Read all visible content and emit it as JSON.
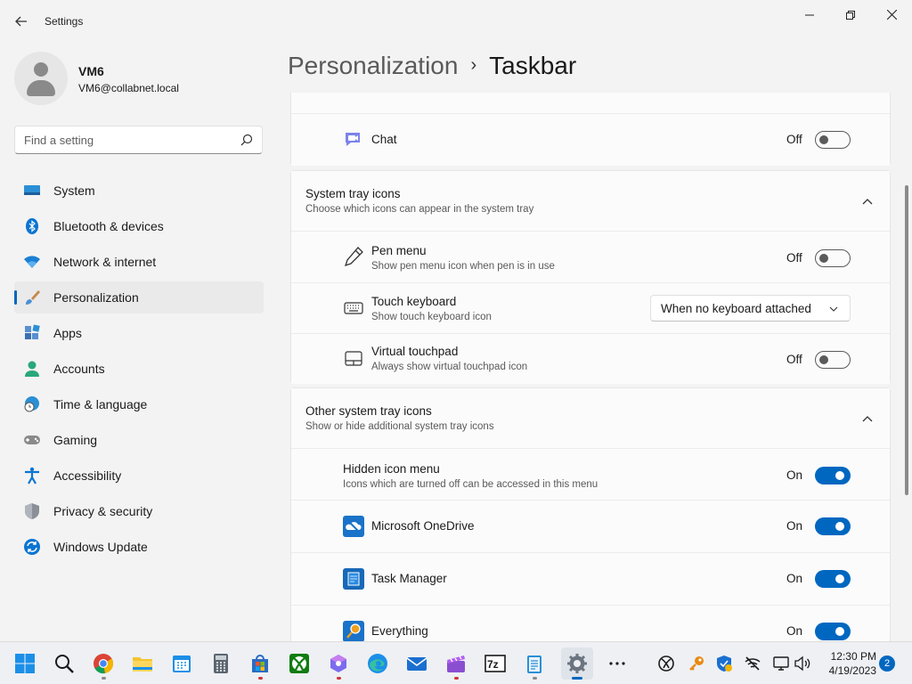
{
  "window": {
    "title": "Settings",
    "back_icon": "back-arrow-icon",
    "controls": [
      "minimize-icon",
      "maximize-icon",
      "close-icon"
    ]
  },
  "profile": {
    "name": "VM6",
    "email": "VM6@collabnet.local"
  },
  "search": {
    "placeholder": "Find a setting"
  },
  "nav": {
    "items": [
      {
        "label": "System",
        "icon": "system-icon"
      },
      {
        "label": "Bluetooth & devices",
        "icon": "bluetooth-icon"
      },
      {
        "label": "Network & internet",
        "icon": "wifi-icon"
      },
      {
        "label": "Personalization",
        "icon": "brush-icon",
        "active": true
      },
      {
        "label": "Apps",
        "icon": "apps-icon"
      },
      {
        "label": "Accounts",
        "icon": "person-icon"
      },
      {
        "label": "Time & language",
        "icon": "globe-clock-icon"
      },
      {
        "label": "Gaming",
        "icon": "gamepad-icon"
      },
      {
        "label": "Accessibility",
        "icon": "accessibility-icon"
      },
      {
        "label": "Privacy & security",
        "icon": "shield-icon"
      },
      {
        "label": "Windows Update",
        "icon": "update-icon"
      }
    ]
  },
  "header": {
    "parent": "Personalization",
    "separator": "›",
    "current": "Taskbar"
  },
  "taskbar_items": {
    "chat": {
      "label": "Chat",
      "state": "Off",
      "on": false
    }
  },
  "system_tray": {
    "title": "System tray icons",
    "subtitle": "Choose which icons can appear in the system tray",
    "items": [
      {
        "label": "Pen menu",
        "desc": "Show pen menu icon when pen is in use",
        "state": "Off",
        "on": false,
        "icon": "pen-icon"
      },
      {
        "label": "Touch keyboard",
        "desc": "Show touch keyboard icon",
        "dropdown": "When no keyboard attached",
        "icon": "keyboard-icon"
      },
      {
        "label": "Virtual touchpad",
        "desc": "Always show virtual touchpad icon",
        "state": "Off",
        "on": false,
        "icon": "touchpad-icon"
      }
    ]
  },
  "other_tray": {
    "title": "Other system tray icons",
    "subtitle": "Show or hide additional system tray icons",
    "hidden_menu": {
      "label": "Hidden icon menu",
      "desc": "Icons which are turned off can be accessed in this menu",
      "state": "On",
      "on": true
    },
    "items": [
      {
        "label": "Microsoft OneDrive",
        "state": "On",
        "on": true,
        "icon": "onedrive-icon"
      },
      {
        "label": "Task Manager",
        "state": "On",
        "on": true,
        "icon": "task-manager-icon"
      },
      {
        "label": "Everything",
        "state": "On",
        "on": true,
        "icon": "everything-search-icon"
      }
    ]
  },
  "taskbar": {
    "apps": [
      "start-icon",
      "search-icon",
      "chrome-icon",
      "file-explorer-icon",
      "calendar-icon",
      "calculator-icon",
      "store-icon",
      "xbox-icon",
      "copilot-icon",
      "edge-icon",
      "mail-icon",
      "clapperboard-icon",
      "7zip-icon",
      "notepad-icon",
      "settings-icon",
      "more-icon"
    ],
    "tray": [
      "xbox-tray-icon",
      "key-tray-icon",
      "defender-tray-icon",
      "network-off-icon",
      "display-icon",
      "volume-icon"
    ],
    "time": "12:30 PM",
    "date": "4/19/2023",
    "notifications": "2"
  },
  "colors": {
    "accent": "#0067c0",
    "background": "#f3f3f3",
    "card": "#fbfbfb"
  }
}
